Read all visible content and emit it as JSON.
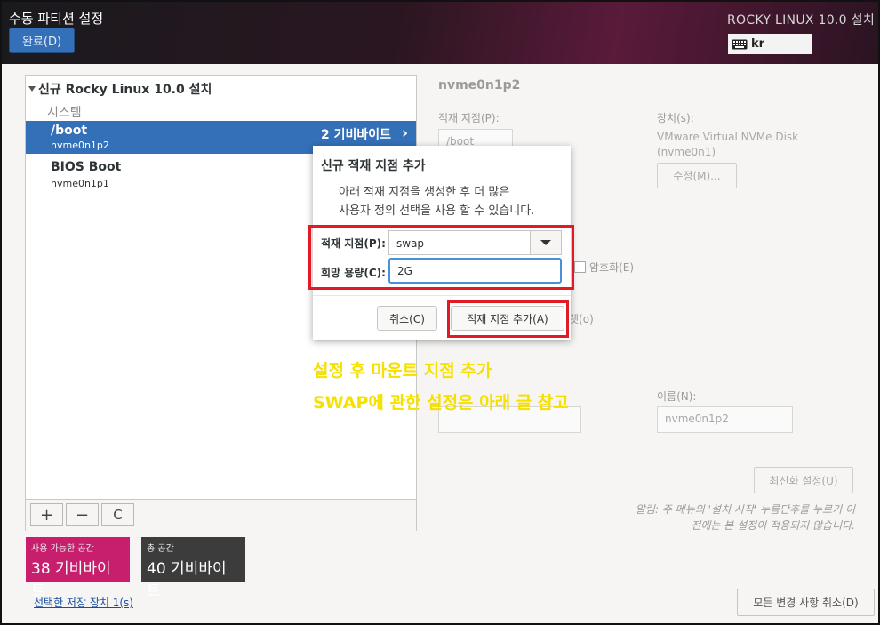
{
  "header": {
    "title": "수동 파티션 설정",
    "done_button": "완료(D)",
    "install_title": "ROCKY LINUX 10.0 설치",
    "keyboard_layout": "kr"
  },
  "left_panel": {
    "tree_title": "신규 Rocky Linux 10.0 설치",
    "section_label": "시스템",
    "partitions": [
      {
        "mount": "/boot",
        "device": "nvme0n1p2",
        "size": "2 기비바이트",
        "selected": true
      },
      {
        "mount": "BIOS Boot",
        "device": "nvme0n1p1"
      }
    ],
    "toolbar": {
      "add": "+",
      "remove": "−",
      "refresh": "C"
    }
  },
  "space": {
    "available_label": "사용 가능한 공간",
    "available_value": "38 기비바이트",
    "available_color": "#c81e6e",
    "total_label": "총 공간",
    "total_value": "40 기비바이트",
    "total_color": "#3c3c3c"
  },
  "selected_devices_link": "선택한 저장 장치 1(s)",
  "right_panel": {
    "title": "nvme0n1p2",
    "mount_point_label": "적재 지점(P):",
    "mount_point_value": "/boot",
    "device_label": "장치(s):",
    "device_value_line1": "VMware Virtual NVMe Disk",
    "device_value_line2": "(nvme0n1)",
    "modify_button": "수정(M)...",
    "encrypt_label": "암호화(E)",
    "fragment_text": "렛(o)",
    "name_label": "이름(N):",
    "name_value": "nvme0n1p2",
    "reset_button": "최신화 설정(U)",
    "note_line1": "알림: 주 메뉴의 '설치 시작' 누름단추를 누르기 이",
    "note_line2": "전에는 본 설정이 적용되지 않습니다.",
    "reset_all_button": "모든 변경 사항 취소(D)"
  },
  "dialog": {
    "title": "신규 적재 지점 추가",
    "desc_line1": "아래 적재 지점을 생성한 후 더 많은",
    "desc_line2": "사용자 정의 선택을 사용 할 수 있습니다.",
    "mount_label": "적재 지점(P):",
    "mount_value": "swap",
    "capacity_label": "희망 용량(C):",
    "capacity_value": "2G",
    "cancel_button": "취소(C)",
    "add_button": "적재 지점 추가(A)"
  },
  "annotations": {
    "line1": "설정 후 마운트 지점 추가",
    "line2": "SWAP에 관한 설정은 아래 글 참고",
    "highlight_color": "#e01b24",
    "text_color": "#f5e000"
  }
}
